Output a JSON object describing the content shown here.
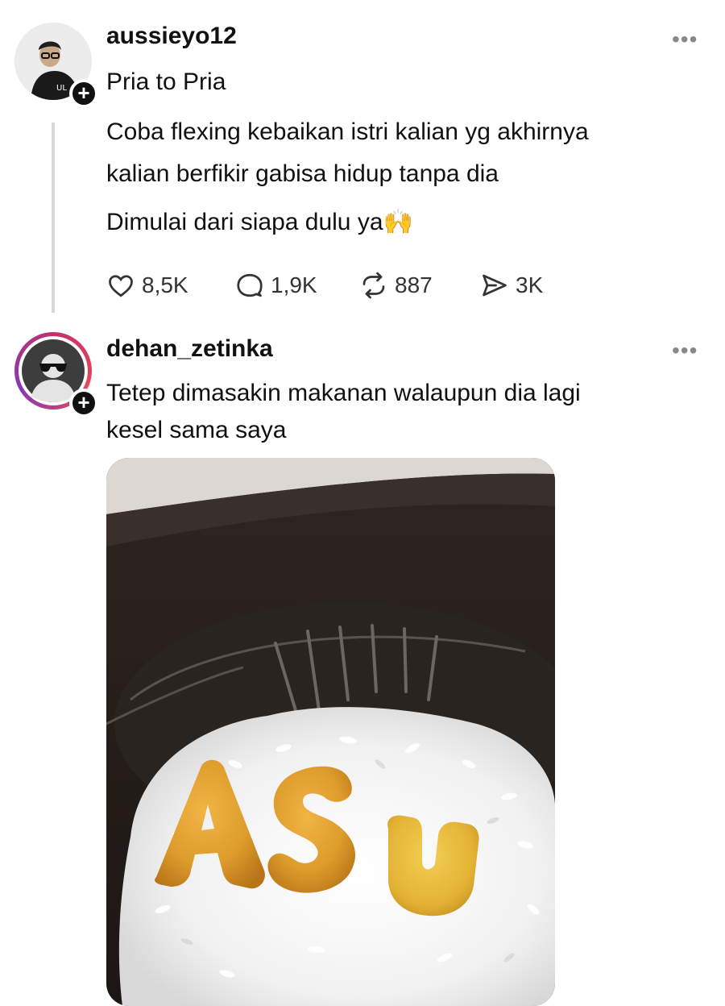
{
  "posts": [
    {
      "username": "aussieyo12",
      "lines": [
        "Pria to Pria",
        "Coba flexing kebaikan istri kalian yg akhirnya",
        "kalian berfikir gabisa hidup tanpa dia",
        "Dimulai dari siapa dulu ya🙌"
      ],
      "actions": {
        "likes": "8,5K",
        "comments": "1,9K",
        "reposts": "887",
        "shares": "3K"
      }
    },
    {
      "username": "dehan_zetinka",
      "lines": [
        "Tetep dimasakin makanan walaupun dia lagi",
        "kesel sama saya"
      ],
      "photo_caption_letters": "ASU"
    }
  ],
  "icons": {
    "more": "more-horizontal-icon",
    "follow": "plus-icon",
    "like": "heart-icon",
    "comment": "comment-icon",
    "repost": "repost-icon",
    "share": "send-icon"
  },
  "colors": {
    "text": "#111111",
    "muted": "#888888",
    "thread_line": "#d9d9d9",
    "background": "#ffffff"
  }
}
